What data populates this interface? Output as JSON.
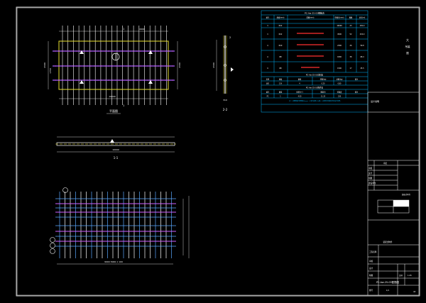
{
  "drawing": {
    "views": {
      "plan_label": "平面图",
      "section_11_label": "1-1",
      "section_22_label": "2-2",
      "plan_section_mark_top": "1",
      "plan_section_mark_bottom": "1",
      "side_section_mark": "2"
    },
    "plan_dims": {
      "overall_width": "10000",
      "width_right": "4990",
      "height_left": "4500",
      "height_left_lower": "1750"
    },
    "section_dims": {
      "overall_width": "10000"
    },
    "side_dims": {
      "height": "4500",
      "bottom": "310"
    },
    "rebar_dims": {
      "bottom_span": "9990·5000·1 100"
    },
    "schedule_main": {
      "title": "PC-Aw-25-03钢筋表",
      "headers": [
        "编号",
        "规格(mm)",
        "简图(mm)",
        "单根长(mm)",
        "根数",
        "总长(m)"
      ],
      "rows": [
        [
          "①",
          "Φ12",
          "",
          "10000",
          "23",
          "230.0"
        ],
        [
          "②",
          "Φ12",
          "",
          "4500",
          "52",
          "234.0"
        ],
        [
          "③",
          "Φ10",
          "",
          "2300",
          "26",
          "59.8"
        ],
        [
          "④",
          "Φ8",
          "",
          "1800",
          "38",
          "68.4"
        ],
        [
          "⑤",
          "Φ8",
          "",
          "1500",
          "17",
          "25.5"
        ]
      ]
    },
    "schedule_sub1": {
      "title": "PC-Aw-25-03材料表",
      "headers": [
        "名称",
        "规格",
        "数量",
        "单重(kg)",
        "总重(kg)",
        "备注"
      ],
      "rows": [
        [
          "吊钉",
          "2.5t",
          "4",
          "0.20",
          "0.80",
          ""
        ]
      ]
    },
    "schedule_sub2": {
      "title": "PC-Aw-25-03构件表",
      "headers": [
        "编号",
        "数量",
        "体积(m³)",
        "重量(t)",
        "砼强度",
        "备注"
      ],
      "rows": [
        [
          "PC",
          "1",
          "4.50",
          "11.25",
          "C30",
          ""
        ]
      ]
    },
    "note_line1": "注：1.钢筋保护层厚度25mm；2.吊钉采用2.5t级；3.其他未尽事宜详见设计说明。",
    "note_line2": "",
    "side_stamp": [
      "大",
      "吊装",
      "图"
    ],
    "title_block": {
      "design_note": "设计说明",
      "approver_label": "审定",
      "checker_label": "审核",
      "designer_label": "设计",
      "drawn_label": "制图",
      "project_label": "工程名称",
      "scale_label": "比例",
      "scale_value": "1:25",
      "drawing_no_label": "图号",
      "drawing_no": "PC-Aw-25-03配筋图",
      "sheet": "1/1",
      "corner": "43",
      "small_label": "装配式构件",
      "owner_label": "建设单位"
    }
  }
}
